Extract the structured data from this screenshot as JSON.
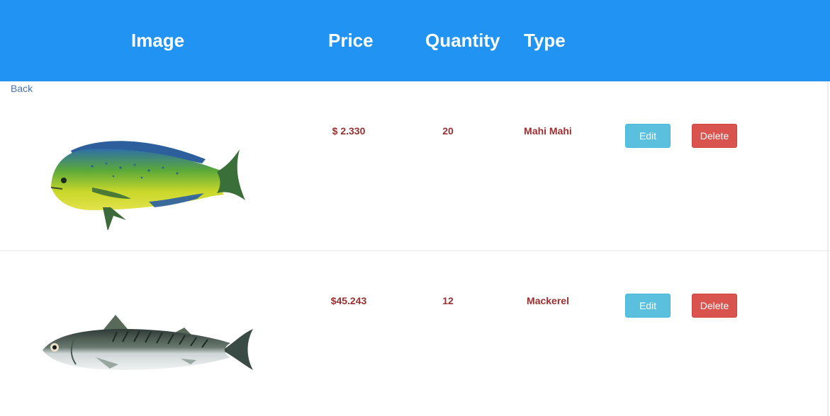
{
  "header": {
    "col_image": "Image",
    "col_price": "Price",
    "col_quantity": "Quantity",
    "col_type": "Type"
  },
  "nav": {
    "back_label": "Back"
  },
  "rows": [
    {
      "price": "$ 2.330",
      "quantity": "20",
      "type": "Mahi Mahi",
      "edit_label": "Edit",
      "delete_label": "Delete",
      "image": "mahi-mahi-fish-image"
    },
    {
      "price": "$45.243",
      "quantity": "12",
      "type": "Mackerel",
      "edit_label": "Edit",
      "delete_label": "Delete",
      "image": "mackerel-fish-image"
    }
  ],
  "colors": {
    "header_bg": "#2193f3",
    "cell_text": "#9b2f2f",
    "edit_button": "#5bc0de",
    "delete_button": "#d9534f",
    "link": "#4a72a8"
  }
}
